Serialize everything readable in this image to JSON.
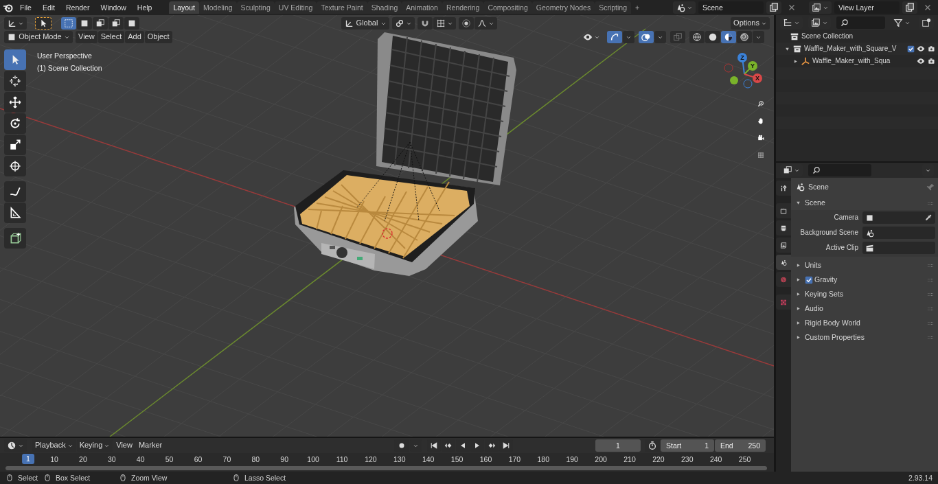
{
  "menu": [
    "File",
    "Edit",
    "Render",
    "Window",
    "Help"
  ],
  "workspaces": [
    {
      "label": "Layout",
      "selected": true
    },
    {
      "label": "Modeling",
      "selected": false
    },
    {
      "label": "Sculpting",
      "selected": false
    },
    {
      "label": "UV Editing",
      "selected": false
    },
    {
      "label": "Texture Paint",
      "selected": false
    },
    {
      "label": "Shading",
      "selected": false
    },
    {
      "label": "Animation",
      "selected": false
    },
    {
      "label": "Rendering",
      "selected": false
    },
    {
      "label": "Compositing",
      "selected": false
    },
    {
      "label": "Geometry Nodes",
      "selected": false
    },
    {
      "label": "Scripting",
      "selected": false
    }
  ],
  "add_workspace": "+",
  "scene_field": {
    "value": "Scene"
  },
  "view_layer_field": {
    "value": "View Layer"
  },
  "viewport": {
    "select_modes": [
      {
        "selected": true
      },
      {
        "selected": false
      },
      {
        "selected": false
      },
      {
        "selected": false
      },
      {
        "selected": false
      }
    ],
    "orientation": "Global",
    "options": "Options",
    "mode": "Object Mode",
    "menus": [
      "View",
      "Select",
      "Add",
      "Object"
    ],
    "gizmos_on": true,
    "overlays_on": true,
    "shading_modes": [
      {
        "selected": false
      },
      {
        "selected": false
      },
      {
        "selected": true
      },
      {
        "selected": false
      }
    ],
    "overlay_text": [
      "User Perspective",
      "(1) Scene Collection"
    ],
    "tools": [
      {
        "selected": true
      },
      {
        "selected": false
      },
      {
        "selected": false
      },
      {
        "selected": false
      },
      {
        "selected": false
      },
      {
        "selected": false
      },
      {
        "selected": false
      },
      {
        "selected": false
      },
      {
        "selected": false
      }
    ],
    "gizmo_axes": [
      "Z",
      "Y",
      "X"
    ]
  },
  "outliner": {
    "root": "Scene Collection",
    "items": [
      {
        "label": "Waffle_Maker_with_Square_V",
        "expanded": true,
        "checked": true,
        "children": [
          {
            "label": "Waffle_Maker_with_Squa",
            "expanded": false
          }
        ]
      }
    ]
  },
  "properties": {
    "tabs": [
      {
        "selected": false
      },
      {
        "selected": false
      },
      {
        "selected": false
      },
      {
        "selected": false
      },
      {
        "selected": true
      },
      {
        "selected": false
      },
      {
        "selected": false
      }
    ],
    "context": "Scene",
    "panels": [
      {
        "title": "Scene",
        "expanded": true,
        "fields": [
          {
            "label": "Camera"
          },
          {
            "label": "Background Scene"
          },
          {
            "label": "Active Clip"
          }
        ]
      },
      {
        "title": "Units",
        "expanded": false
      },
      {
        "title": "Gravity",
        "expanded": false,
        "checked": true
      },
      {
        "title": "Keying Sets",
        "expanded": false
      },
      {
        "title": "Audio",
        "expanded": false
      },
      {
        "title": "Rigid Body World",
        "expanded": false
      },
      {
        "title": "Custom Properties",
        "expanded": false
      }
    ]
  },
  "timeline": {
    "menus": [
      "Playback",
      "Keying",
      "View",
      "Marker"
    ],
    "current_frame": "1",
    "start_label": "Start",
    "start": "1",
    "end_label": "End",
    "end": "250",
    "current_marker": "1",
    "frame_labels": [
      "10",
      "20",
      "30",
      "40",
      "50",
      "60",
      "70",
      "80",
      "90",
      "100",
      "110",
      "120",
      "130",
      "140",
      "150",
      "160",
      "170",
      "180",
      "190",
      "200",
      "210",
      "220",
      "230",
      "240",
      "250"
    ]
  },
  "status_bar": {
    "hints": [
      "Select",
      "Box Select",
      "Zoom View",
      "Lasso Select"
    ],
    "version": "2.93.14"
  }
}
